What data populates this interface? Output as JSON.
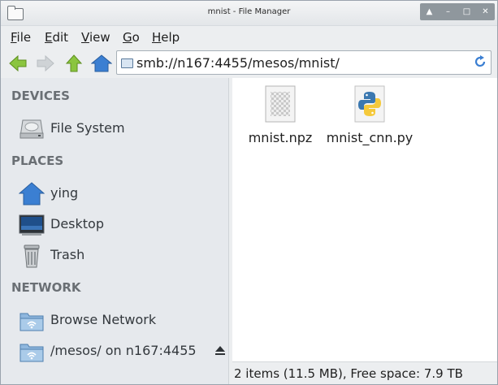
{
  "window": {
    "title": "mnist - File Manager"
  },
  "menu": {
    "items": [
      {
        "label": "File",
        "mnemonic": "F",
        "rest": "ile"
      },
      {
        "label": "Edit",
        "mnemonic": "E",
        "rest": "dit"
      },
      {
        "label": "View",
        "mnemonic": "V",
        "rest": "iew"
      },
      {
        "label": "Go",
        "mnemonic": "G",
        "rest": "o"
      },
      {
        "label": "Help",
        "mnemonic": "H",
        "rest": "elp"
      }
    ]
  },
  "toolbar": {
    "location": "smb://n167:4455/mesos/mnist/",
    "icons": [
      "back-arrow-icon",
      "forward-arrow-icon",
      "up-arrow-icon",
      "home-icon",
      "reload-icon"
    ]
  },
  "sidebar": {
    "devices_heading": "DEVICES",
    "places_heading": "PLACES",
    "network_heading": "NETWORK",
    "devices": [
      {
        "label": "File System",
        "icon": "drive-icon"
      }
    ],
    "places": [
      {
        "label": "ying",
        "icon": "home-folder-icon"
      },
      {
        "label": "Desktop",
        "icon": "desktop-icon"
      },
      {
        "label": "Trash",
        "icon": "trash-icon"
      }
    ],
    "network": [
      {
        "label": "Browse Network",
        "icon": "network-folder-icon"
      },
      {
        "label": "/mesos/ on n167:4455",
        "icon": "network-folder-icon"
      }
    ]
  },
  "files": [
    {
      "name": "mnist.npz",
      "icon": "generic-file-icon"
    },
    {
      "name": "mnist_cnn.py",
      "icon": "python-file-icon"
    }
  ],
  "status": {
    "text": "2 items (11.5 MB), Free space: 7.9 TB"
  },
  "colors": {
    "accent": "#3b7fd2",
    "arrow_green": "#7fbf1e",
    "sidebar_bg": "#e6e9ed"
  }
}
